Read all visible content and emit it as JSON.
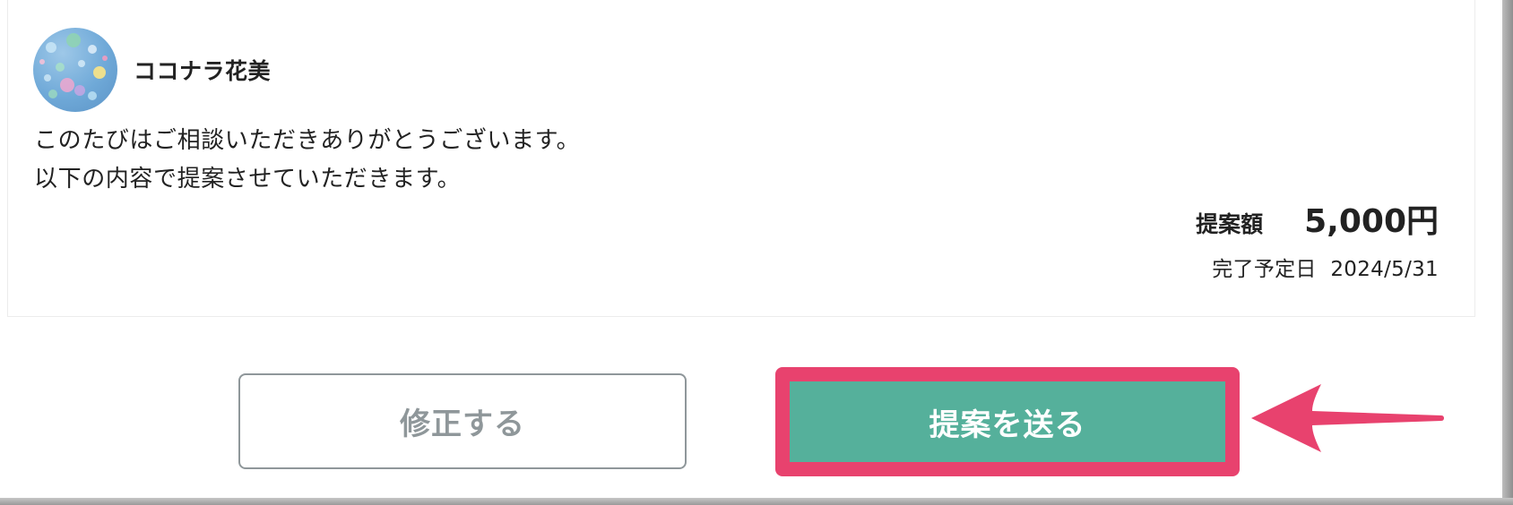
{
  "proposal": {
    "seller_name": "ココナラ花美",
    "message_line_1": "このたびはご相談いただきありがとうございます。",
    "message_line_2": "以下の内容で提案させていただきます。",
    "price_label": "提案額",
    "price_value": "5,000円",
    "due_label": "完了予定日",
    "due_date": "2024/5/31"
  },
  "actions": {
    "edit_label": "修正する",
    "send_label": "提案を送る"
  },
  "colors": {
    "send_button": "#55b09b",
    "highlight": "#e8426e",
    "edit_border": "#8f979a"
  },
  "icons": {
    "avatar": "balloons-avatar",
    "annotation": "pink-arrow-icon"
  }
}
